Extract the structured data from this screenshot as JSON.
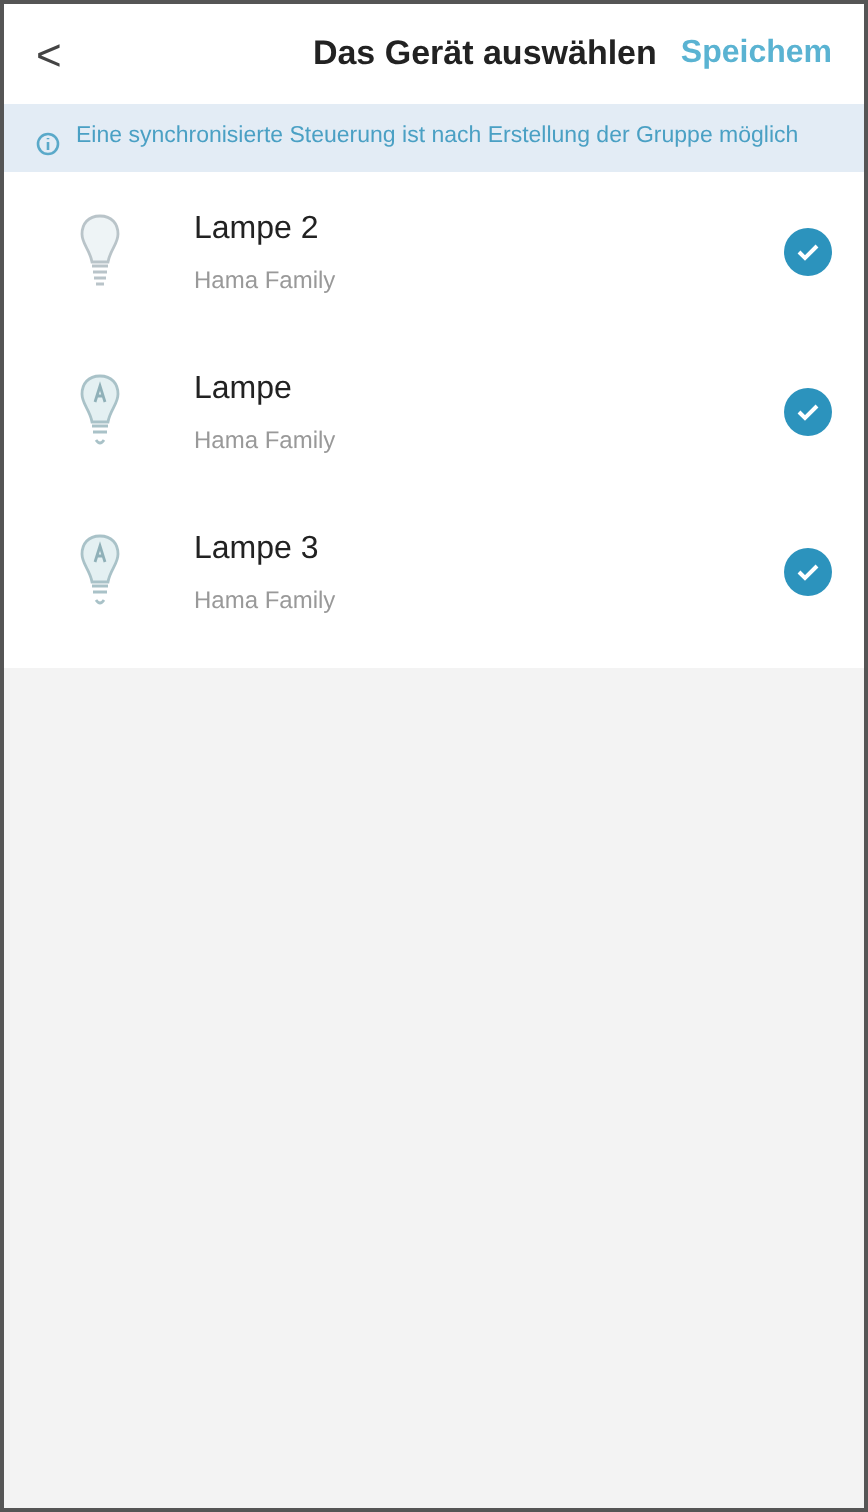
{
  "header": {
    "back": "<",
    "title": "Das Gerät auswählen",
    "action": "Speichem"
  },
  "notice": "Eine synchronisierte Steuerung ist nach Erstellung der Gruppe möglich",
  "devices": [
    {
      "name": "Lampe 2",
      "group": "Hama Family",
      "kind": "plain",
      "checked": true
    },
    {
      "name": "Lampe",
      "group": "Hama Family",
      "kind": "filament",
      "checked": true
    },
    {
      "name": "Lampe 3",
      "group": "Hama Family",
      "kind": "filament",
      "checked": true
    }
  ]
}
